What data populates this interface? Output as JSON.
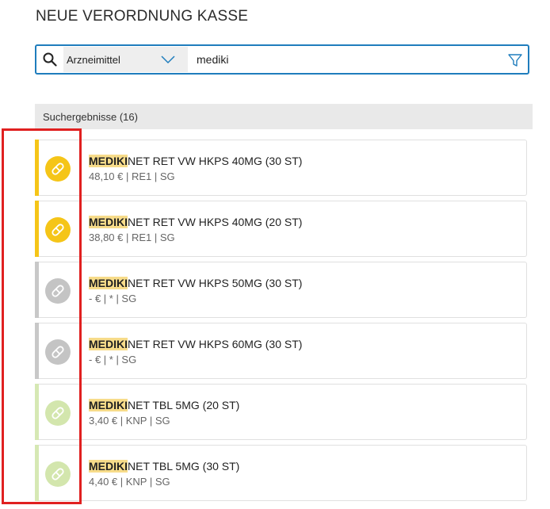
{
  "page_title": "NEUE VERORDNUNG KASSE",
  "search": {
    "category": "Arzneimittel",
    "query": "mediki",
    "icons": {
      "search": "search-icon",
      "dropdown": "chevron-down-icon",
      "filter": "filter-icon"
    },
    "accent_color": "#1f7dbd"
  },
  "results": {
    "header": "Suchergebnisse (16)",
    "items": [
      {
        "highlight": "MEDIKI",
        "rest": "NET RET VW HKPS 40MG (30 ST)",
        "meta": "48,10 € | RE1 | SG",
        "status_color": "#f5c518",
        "icon_color": "#f5c518",
        "icon": "pill-icon"
      },
      {
        "highlight": "MEDIKI",
        "rest": "NET RET VW HKPS 40MG (20 ST)",
        "meta": "38,80 € | RE1 | SG",
        "status_color": "#f5c518",
        "icon_color": "#f5c518",
        "icon": "pill-icon"
      },
      {
        "highlight": "MEDIKI",
        "rest": "NET RET VW HKPS 50MG (30 ST)",
        "meta": "- € | * | SG",
        "status_color": "#c8c8c8",
        "icon_color": "#c4c4c4",
        "icon": "pill-icon"
      },
      {
        "highlight": "MEDIKI",
        "rest": "NET RET VW HKPS 60MG (30 ST)",
        "meta": "- € | * | SG",
        "status_color": "#c8c8c8",
        "icon_color": "#c4c4c4",
        "icon": "pill-icon"
      },
      {
        "highlight": "MEDIKI",
        "rest": "NET TBL 5MG (20 ST)",
        "meta": "3,40 € | KNP | SG",
        "status_color": "#d6e8b4",
        "icon_color": "#d3e6ad",
        "icon": "pill-icon"
      },
      {
        "highlight": "MEDIKI",
        "rest": "NET TBL 5MG (30 ST)",
        "meta": "4,40 € | KNP | SG",
        "status_color": "#d6e8b4",
        "icon_color": "#d3e6ad",
        "icon": "pill-icon"
      }
    ]
  },
  "annotation_color": "#e02020"
}
